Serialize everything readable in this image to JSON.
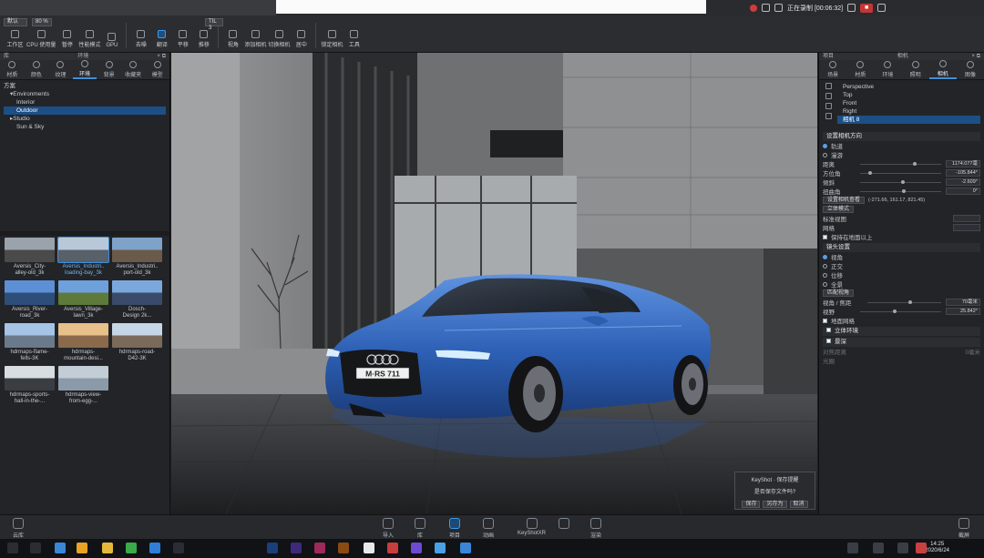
{
  "top": {
    "recording_text": "正在录制 [00:06:32]"
  },
  "toolbar": {
    "preset_select": "默认",
    "percent_select": "80 %",
    "items": [
      "工作区",
      "CPU 使用量",
      "暂停",
      "性能模式",
      "GPU",
      "去噪",
      "翻译",
      "平移",
      "推移",
      "视角",
      "添加相机",
      "切换相机",
      "居中",
      "锁定相机",
      "工具"
    ],
    "active_index": 6,
    "mini_select": "TIL 3"
  },
  "left_panel": {
    "head_left": "库",
    "head_title": "环境",
    "tabs": [
      "材质",
      "颜色",
      "纹理",
      "环境",
      "背景",
      "收藏夹",
      "模型"
    ],
    "active_tab": 3,
    "tree_root": "方案",
    "tree": [
      {
        "label": "Environments",
        "indent": 1,
        "prefix": "▾"
      },
      {
        "label": "Interior",
        "indent": 2,
        "prefix": ""
      },
      {
        "label": "Outdoor",
        "indent": 2,
        "prefix": "",
        "selected": true
      },
      {
        "label": "Studio",
        "indent": 1,
        "prefix": "▸"
      },
      {
        "label": "Sun & Sky",
        "indent": 2,
        "prefix": ""
      }
    ],
    "thumbnails": [
      {
        "label": "Aversis_City-\nalley-old_3k",
        "c1": "#9aa3ac",
        "c2": "#4a4a4a"
      },
      {
        "label": "Aversis_Industri..\nloading-bay_3k",
        "c1": "#b8c8d8",
        "c2": "#58606a",
        "selected": true
      },
      {
        "label": "Aversis_Industri..\nport-old_3k",
        "c1": "#7fa2c8",
        "c2": "#6a5a4a"
      },
      {
        "label": "Aversis_River-\nroad_3k",
        "c1": "#5d8fd6",
        "c2": "#2e4e7a"
      },
      {
        "label": "Aversis_Village-\nlawn_3k",
        "c1": "#6ea0dc",
        "c2": "#5e7a3a"
      },
      {
        "label": "Dosch-\nDesign 2k...",
        "c1": "#7aa8dd",
        "c2": "#3a4a6a"
      },
      {
        "label": "hdrmaps-flame-\nfells-3K",
        "c1": "#a6c4e6",
        "c2": "#6a7a8a"
      },
      {
        "label": "hdrmaps-\nmountain-desi...",
        "c1": "#e8c08a",
        "c2": "#8a6a4a"
      },
      {
        "label": "hdrmaps-road-\nD42-3K",
        "c1": "#c5d6e6",
        "c2": "#7a6a5a"
      },
      {
        "label": "hdrmaps-sports-\nhall-in-the-...",
        "c1": "#d8dde2",
        "c2": "#3a3d42"
      },
      {
        "label": "hdrmaps-view-\nfrom-egg-...",
        "c1": "#c2cdd6",
        "c2": "#8a9aa8"
      }
    ]
  },
  "viewport": {
    "plate_text": "M·RS 711"
  },
  "right_panel": {
    "head_left": "项目",
    "head_title": "相机",
    "tabs": [
      "场景",
      "材质",
      "环境",
      "照明",
      "相机",
      "图像"
    ],
    "active_tab": 4,
    "cameras": [
      {
        "label": "Perspective"
      },
      {
        "label": "Top"
      },
      {
        "label": "Front"
      },
      {
        "label": "Right"
      },
      {
        "label": "相机 8",
        "selected": true
      }
    ],
    "sec_camera_dir": "设置相机方向",
    "radio_orbit": "轨道",
    "radio_walk": "漫游",
    "props": [
      {
        "label": "距离",
        "value": "1174.077毫",
        "pos": 0.65
      },
      {
        "label": "方位角",
        "value": "-105.844°",
        "pos": 0.1
      },
      {
        "label": "倾斜",
        "value": "-2.609°",
        "pos": 0.5
      },
      {
        "label": "扭曲角",
        "value": "0°",
        "pos": 0.52
      }
    ],
    "set_look_at": "设置相机查看",
    "look_at_value": "(-271.66, 161.17, 821.45)",
    "stand_mode": "立体模式",
    "stereo_label": "标准视图",
    "stereo_sub": "网格",
    "keep_on_ground": "保持在地面以上",
    "sec_lens": "镜头设置",
    "lens_options": [
      "视角",
      "正交",
      "位移",
      "全景"
    ],
    "match_perspective": "匹配视角",
    "fov_label": "视角 / 焦距",
    "fov_value": "70毫米",
    "view_label": "视野",
    "view_value": "25.842°",
    "ground_grid": "地面网格",
    "depth_of_field": "立体环境",
    "dof": "景深",
    "focus_dist": "对焦距离",
    "focus_value": "0毫米",
    "aperture": "光圈"
  },
  "dialog": {
    "title": "KeyShot · 保存提醒",
    "message": "是否保存文件吗?",
    "buttons": [
      "保存",
      "另存为",
      "取消"
    ]
  },
  "dock": {
    "left_item": "云库",
    "items": [
      "导入",
      "库",
      "项目",
      "动画",
      "KeyShotXR",
      "渲染"
    ],
    "active_index": 2,
    "right_item": "截屏"
  },
  "taskbar": {
    "time": "14:25",
    "date": "2020/6/24"
  },
  "colors": {
    "accent": "#3f8fd8",
    "selection": "#1c4f86",
    "car_body": "#2f63b8"
  }
}
